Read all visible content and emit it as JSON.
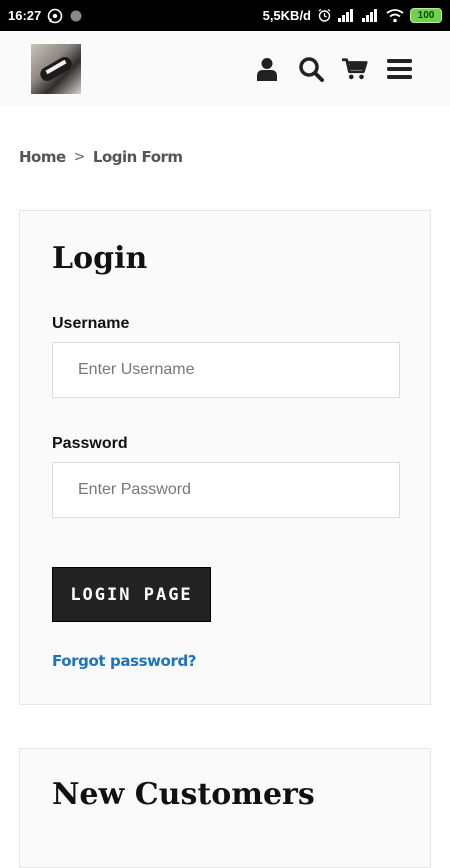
{
  "status_bar": {
    "time": "16:27",
    "network_speed": "5,5KB/d",
    "battery": "100"
  },
  "header": {
    "icons": [
      "user-icon",
      "search-icon",
      "cart-icon",
      "menu-icon"
    ]
  },
  "breadcrumb": {
    "home": "Home",
    "separator": ">",
    "current": "Login Form"
  },
  "login": {
    "title": "Login",
    "username_label": "Username",
    "username_placeholder": "Enter Username",
    "username_value": "",
    "password_label": "Password",
    "password_placeholder": "Enter Password",
    "password_value": "",
    "button_label": "LOGIN PAGE",
    "forgot_label": "Forgot password?"
  },
  "new_customers": {
    "title": "New Customers"
  },
  "colors": {
    "accent_link": "#1f73b7",
    "button_bg": "#222222",
    "battery": "#6ed34a"
  }
}
